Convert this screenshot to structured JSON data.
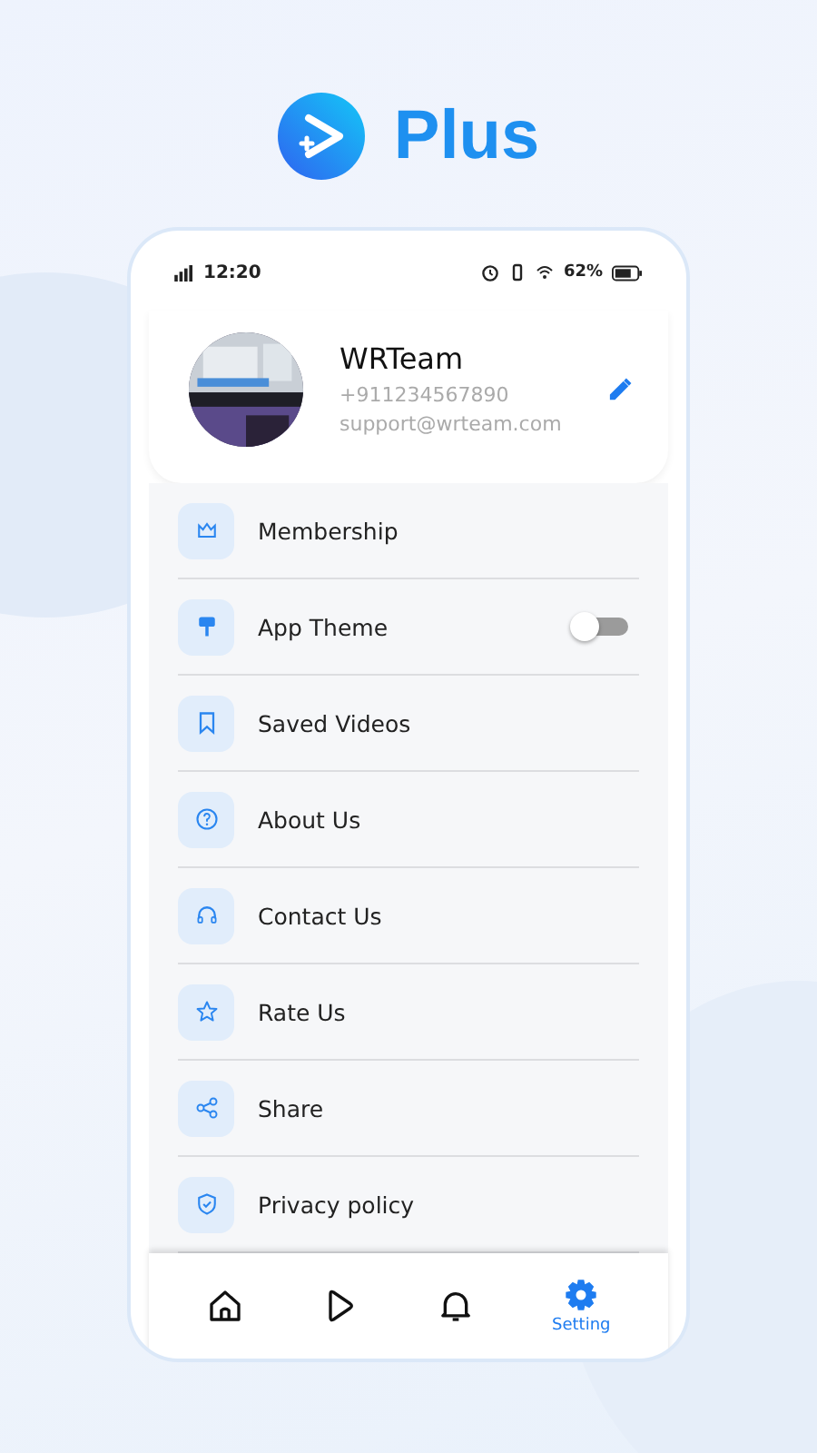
{
  "brand": {
    "name": "Plus"
  },
  "status_bar": {
    "time": "12:20",
    "battery": "62%"
  },
  "profile": {
    "name": "WRTeam",
    "phone": "+911234567890",
    "email": "support@wrteam.com"
  },
  "menu": [
    {
      "label": "Membership",
      "kind": "link"
    },
    {
      "label": "App Theme",
      "kind": "toggle",
      "on": false
    },
    {
      "label": "Saved Videos",
      "kind": "link"
    },
    {
      "label": "About Us",
      "kind": "link"
    },
    {
      "label": "Contact Us",
      "kind": "link"
    },
    {
      "label": "Rate Us",
      "kind": "link"
    },
    {
      "label": "Share",
      "kind": "link"
    },
    {
      "label": "Privacy policy",
      "kind": "link"
    }
  ],
  "nav": [
    {
      "selected": false
    },
    {
      "selected": false
    },
    {
      "selected": false
    },
    {
      "label": "Setting",
      "selected": true
    }
  ]
}
